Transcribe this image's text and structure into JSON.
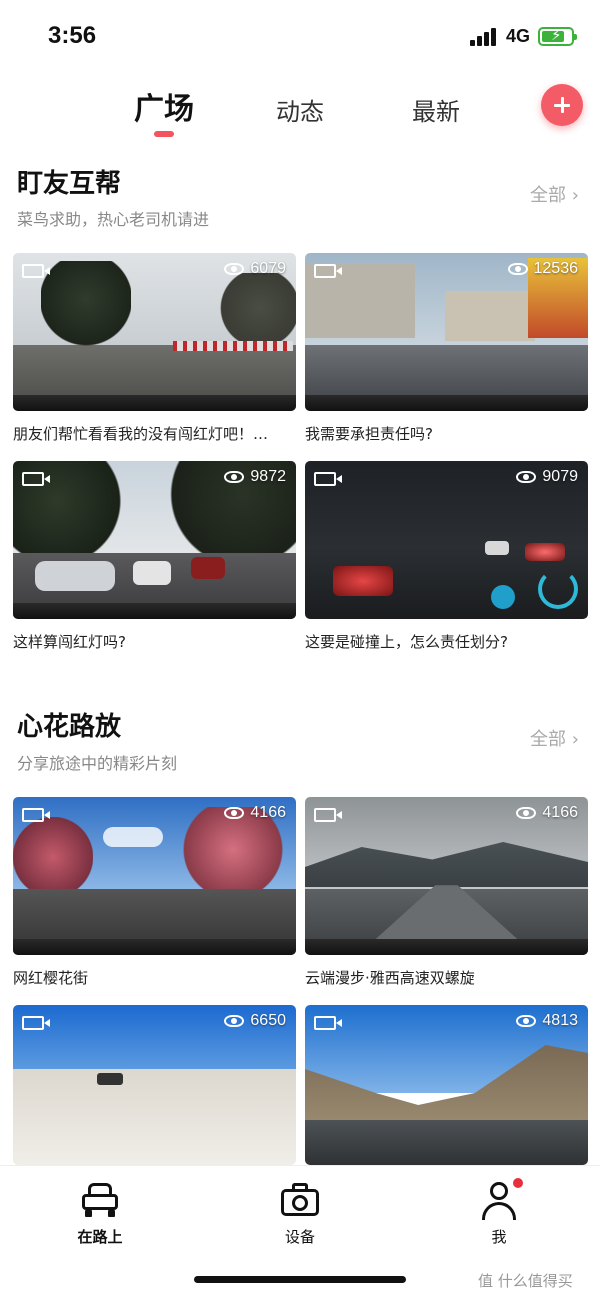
{
  "status": {
    "time": "3:56",
    "network": "4G"
  },
  "tabs": [
    {
      "label": "广场",
      "active": true
    },
    {
      "label": "动态",
      "active": false
    },
    {
      "label": "最新",
      "active": false
    }
  ],
  "colors": {
    "accent": "#f35b66",
    "battery": "#3bb33b"
  },
  "sections": [
    {
      "title": "盯友互帮",
      "subtitle": "菜鸟求助，热心老司机请进",
      "all_label": "全部 ›",
      "cards": [
        {
          "views": "6079",
          "caption": "朋友们帮忙看看我的没有闯红灯吧！…"
        },
        {
          "views": "12536",
          "caption": "我需要承担责任吗?"
        },
        {
          "views": "9872",
          "caption": "这样算闯红灯吗?"
        },
        {
          "views": "9079",
          "caption": "这要是碰撞上，怎么责任划分?"
        }
      ]
    },
    {
      "title": "心花路放",
      "subtitle": "分享旅途中的精彩片刻",
      "all_label": "全部 ›",
      "cards": [
        {
          "views": "4166",
          "caption": "网红樱花街"
        },
        {
          "views": "4166",
          "caption": "云端漫步·雅西高速双螺旋"
        },
        {
          "views": "6650",
          "caption": ""
        },
        {
          "views": "4813",
          "caption": ""
        }
      ]
    }
  ],
  "bottom_nav": [
    {
      "label": "在路上",
      "icon": "car-icon",
      "active": true
    },
    {
      "label": "设备",
      "icon": "camera-icon",
      "active": false
    },
    {
      "label": "我",
      "icon": "user-icon",
      "active": false,
      "notification": true
    }
  ],
  "watermark": "值 什么值得买"
}
